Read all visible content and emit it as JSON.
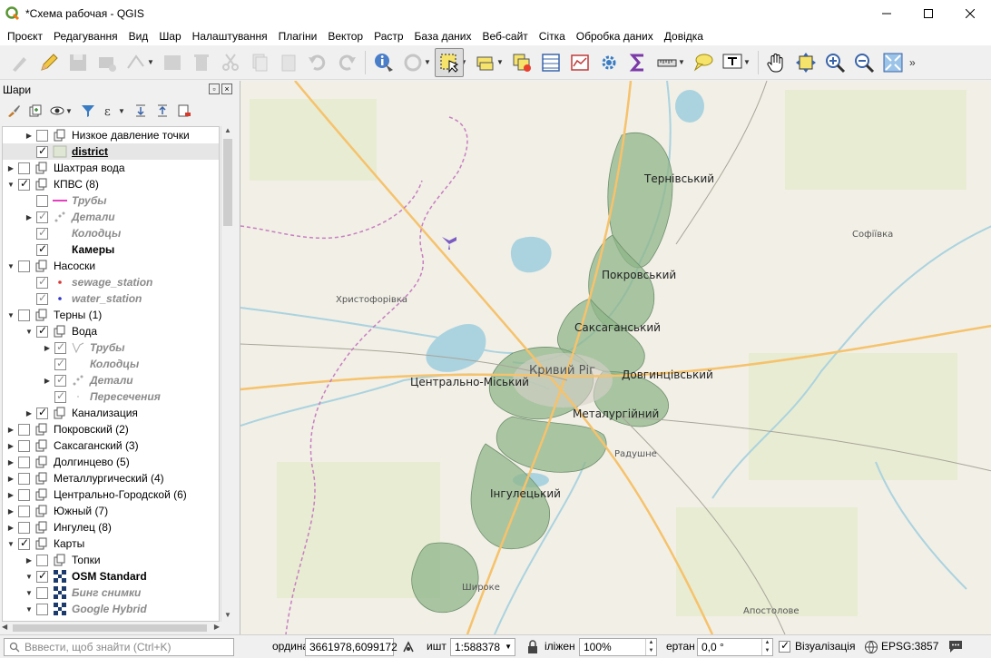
{
  "window": {
    "title": "*Схема рабочая - QGIS"
  },
  "menu": [
    "Проєкт",
    "Редагування",
    "Вид",
    "Шар",
    "Налаштування",
    "Плагіни",
    "Вектор",
    "Растр",
    "База даних",
    "Веб-сайт",
    "Сітка",
    "Обробка даних",
    "Довідка"
  ],
  "layers_panel": {
    "title": "Шари",
    "items": [
      {
        "label": "Низкое давление точки",
        "indent": 1,
        "arrow": "right",
        "checked": false,
        "icon": "group",
        "style": "normal"
      },
      {
        "label": "district",
        "indent": 1,
        "arrow": "",
        "checked": true,
        "icon": "polygon-fill",
        "style": "underline",
        "selected": true
      },
      {
        "label": "Шахтрая вода",
        "indent": 0,
        "arrow": "right",
        "checked": false,
        "icon": "group",
        "style": "normal"
      },
      {
        "label": "КПВС (8)",
        "indent": 0,
        "arrow": "down",
        "checked": true,
        "icon": "group",
        "style": "normal"
      },
      {
        "label": "Трубы",
        "indent": 1,
        "arrow": "",
        "checked": false,
        "icon": "pink-line",
        "style": "italic"
      },
      {
        "label": "Детали",
        "indent": 1,
        "arrow": "right",
        "checked": true,
        "icon": "points-grey",
        "style": "italic"
      },
      {
        "label": "Колодцы",
        "indent": 1,
        "arrow": "",
        "checked": true,
        "icon": "none",
        "style": "italic"
      },
      {
        "label": "Камеры",
        "indent": 1,
        "arrow": "",
        "checked": true,
        "icon": "none",
        "style": "bold"
      },
      {
        "label": "Насоски",
        "indent": 0,
        "arrow": "down",
        "checked": false,
        "icon": "group",
        "style": "normal"
      },
      {
        "label": "sewage_station",
        "indent": 1,
        "arrow": "",
        "checked": true,
        "icon": "dot-red",
        "style": "italic"
      },
      {
        "label": "water_station",
        "indent": 1,
        "arrow": "",
        "checked": true,
        "icon": "dot-blue",
        "style": "italic"
      },
      {
        "label": "Терны (1)",
        "indent": 0,
        "arrow": "down",
        "checked": false,
        "icon": "group",
        "style": "normal"
      },
      {
        "label": "Вода",
        "indent": 1,
        "arrow": "down",
        "checked": true,
        "icon": "group",
        "style": "normal"
      },
      {
        "label": "Трубы",
        "indent": 2,
        "arrow": "right",
        "checked": true,
        "icon": "lines-grey",
        "style": "italic"
      },
      {
        "label": "Колодцы",
        "indent": 2,
        "arrow": "",
        "checked": true,
        "icon": "none",
        "style": "italic"
      },
      {
        "label": "Детали",
        "indent": 2,
        "arrow": "right",
        "checked": true,
        "icon": "points-grey",
        "style": "italic"
      },
      {
        "label": "Пересечения",
        "indent": 2,
        "arrow": "",
        "checked": true,
        "icon": "dot-grey",
        "style": "italic"
      },
      {
        "label": "Канализация",
        "indent": 1,
        "arrow": "right",
        "checked": true,
        "icon": "group",
        "style": "normal"
      },
      {
        "label": "Покровский (2)",
        "indent": 0,
        "arrow": "right",
        "checked": false,
        "icon": "group",
        "style": "normal"
      },
      {
        "label": "Саксаганский (3)",
        "indent": 0,
        "arrow": "right",
        "checked": false,
        "icon": "group",
        "style": "normal"
      },
      {
        "label": "Долгинцево (5)",
        "indent": 0,
        "arrow": "right",
        "checked": false,
        "icon": "group",
        "style": "normal"
      },
      {
        "label": "Металлургический (4)",
        "indent": 0,
        "arrow": "right",
        "checked": false,
        "icon": "group",
        "style": "normal"
      },
      {
        "label": "Центрально-Городской (6)",
        "indent": 0,
        "arrow": "right",
        "checked": false,
        "icon": "group",
        "style": "normal"
      },
      {
        "label": "Южный (7)",
        "indent": 0,
        "arrow": "right",
        "checked": false,
        "icon": "group",
        "style": "normal"
      },
      {
        "label": "Ингулец (8)",
        "indent": 0,
        "arrow": "right",
        "checked": false,
        "icon": "group",
        "style": "normal"
      },
      {
        "label": "Карты",
        "indent": 0,
        "arrow": "down",
        "checked": true,
        "icon": "group",
        "style": "normal"
      },
      {
        "label": "Топки",
        "indent": 1,
        "arrow": "right",
        "checked": false,
        "icon": "group",
        "style": "normal"
      },
      {
        "label": "OSM Standard",
        "indent": 1,
        "arrow": "down",
        "checked": true,
        "icon": "raster",
        "style": "bold"
      },
      {
        "label": "Бинг снимки",
        "indent": 1,
        "arrow": "down",
        "checked": false,
        "icon": "raster",
        "style": "italic"
      },
      {
        "label": "Google Hybrid",
        "indent": 1,
        "arrow": "down",
        "checked": false,
        "icon": "raster",
        "style": "italic"
      }
    ]
  },
  "map": {
    "labels": {
      "ternivskyi": "Тернівський",
      "pokrovskyi": "Покровський",
      "saksahanskyi": "Саксаганський",
      "kryvyi_rih": "Кривий Ріг",
      "tsentralno": "Центрально-Міський",
      "dovhyntsivskyi": "Довгинцівський",
      "metalurhiinyi": "Металургійний",
      "inhuletskyi": "Інгулецький",
      "radushne": "Радушне",
      "khrystoforivka": "Христофорівка",
      "sofiivka": "Софіївка",
      "shyroke": "Широке",
      "apostolove": "Апостолове"
    },
    "colors": {
      "water": "#aad3df",
      "district_fill": "#8fb58a",
      "urban": "#d9d0c9",
      "road": "#f6c26b",
      "border": "#c77fc1"
    }
  },
  "status": {
    "search_placeholder": "Вввести, щоб знайти (Ctrl+K)",
    "coord_label": "ордина",
    "coord_value": "3661978,6099172",
    "scale_label": "ишт",
    "scale_value": "1:588378",
    "magnifier_label": "іліжен",
    "magnifier_value": "100%",
    "rotation_label": "ертан",
    "rotation_value": "0,0 °",
    "render_label": "Візуалізація",
    "crs": "EPSG:3857"
  }
}
